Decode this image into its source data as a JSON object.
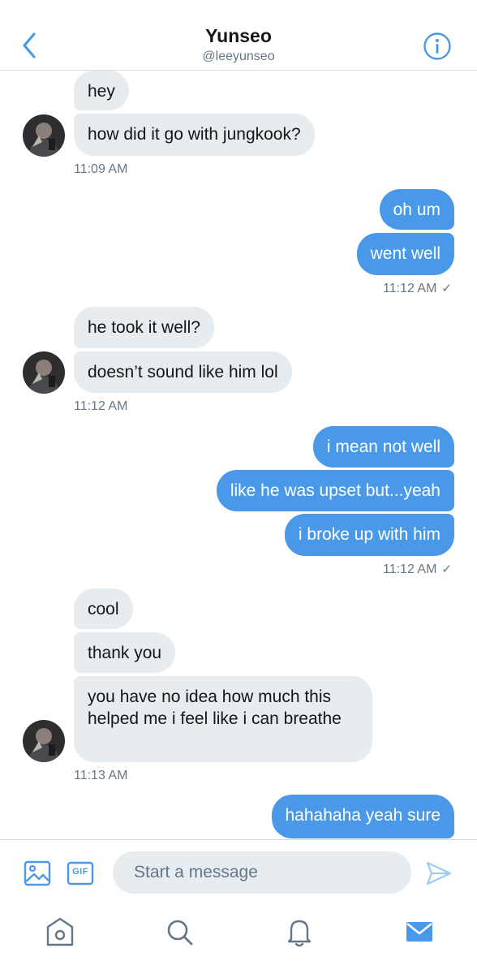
{
  "header": {
    "title": "Yunseo",
    "handle": "@leeyunseo"
  },
  "messages": [
    {
      "id": "m1",
      "side": "in",
      "text": "hey"
    },
    {
      "id": "m2",
      "side": "in",
      "text": "how did it go with jungkook?"
    },
    {
      "id": "t1",
      "type": "timestamp",
      "text": "11:09 AM"
    },
    {
      "id": "m3",
      "side": "out",
      "text": "oh um"
    },
    {
      "id": "m4",
      "side": "out",
      "text": "went well"
    },
    {
      "id": "t2",
      "type": "timestamp",
      "text": "11:12 AM",
      "read_check": "✓"
    },
    {
      "id": "m5",
      "side": "in",
      "text": "he took it well?"
    },
    {
      "id": "m6",
      "side": "in",
      "text": "doesn’t sound like him lol"
    },
    {
      "id": "t3",
      "type": "timestamp",
      "text": "11:12 AM"
    },
    {
      "id": "m7",
      "side": "out",
      "text": "i mean not well"
    },
    {
      "id": "m8",
      "side": "out",
      "text": "like he was upset but...yeah"
    },
    {
      "id": "m9",
      "side": "out",
      "text": "i broke up with him"
    },
    {
      "id": "t4",
      "type": "timestamp",
      "text": "11:12 AM",
      "read_check": "✓"
    },
    {
      "id": "m10",
      "side": "in",
      "text": "cool"
    },
    {
      "id": "m11",
      "side": "in",
      "text": "thank you"
    },
    {
      "id": "m12",
      "side": "in",
      "text": "you have no idea how much this helped me i feel like i can breathe"
    },
    {
      "id": "t5",
      "type": "timestamp",
      "text": "11:13 AM"
    },
    {
      "id": "m13",
      "side": "out",
      "text": "hahahaha yeah sure"
    }
  ],
  "composer": {
    "placeholder": "Start a message",
    "gif_label": "GIF"
  },
  "colors": {
    "accent": "#4a99e9",
    "incoming_bubble": "#e6ecf0",
    "muted_text": "#657786"
  },
  "icons": {
    "back": "chevron-left-icon",
    "info": "info-icon",
    "image": "image-icon",
    "gif": "gif-icon",
    "send": "send-icon",
    "home": "home-icon",
    "search": "search-icon",
    "notifications": "bell-icon",
    "messages": "mail-icon"
  }
}
